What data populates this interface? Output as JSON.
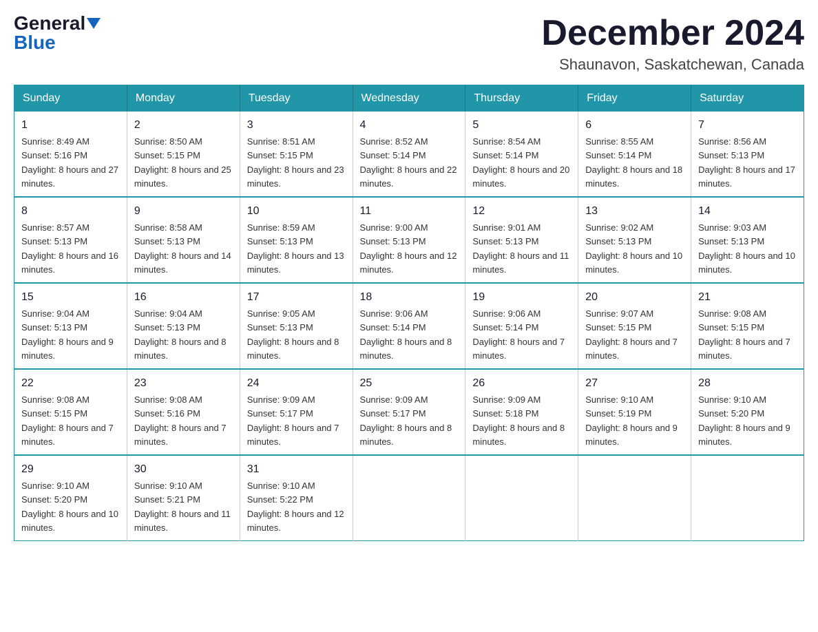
{
  "header": {
    "logo_general": "General",
    "logo_blue": "Blue",
    "month_title": "December 2024",
    "location": "Shaunavon, Saskatchewan, Canada"
  },
  "days_of_week": [
    "Sunday",
    "Monday",
    "Tuesday",
    "Wednesday",
    "Thursday",
    "Friday",
    "Saturday"
  ],
  "weeks": [
    [
      {
        "day": "1",
        "sunrise": "8:49 AM",
        "sunset": "5:16 PM",
        "daylight": "8 hours and 27 minutes."
      },
      {
        "day": "2",
        "sunrise": "8:50 AM",
        "sunset": "5:15 PM",
        "daylight": "8 hours and 25 minutes."
      },
      {
        "day": "3",
        "sunrise": "8:51 AM",
        "sunset": "5:15 PM",
        "daylight": "8 hours and 23 minutes."
      },
      {
        "day": "4",
        "sunrise": "8:52 AM",
        "sunset": "5:14 PM",
        "daylight": "8 hours and 22 minutes."
      },
      {
        "day": "5",
        "sunrise": "8:54 AM",
        "sunset": "5:14 PM",
        "daylight": "8 hours and 20 minutes."
      },
      {
        "day": "6",
        "sunrise": "8:55 AM",
        "sunset": "5:14 PM",
        "daylight": "8 hours and 18 minutes."
      },
      {
        "day": "7",
        "sunrise": "8:56 AM",
        "sunset": "5:13 PM",
        "daylight": "8 hours and 17 minutes."
      }
    ],
    [
      {
        "day": "8",
        "sunrise": "8:57 AM",
        "sunset": "5:13 PM",
        "daylight": "8 hours and 16 minutes."
      },
      {
        "day": "9",
        "sunrise": "8:58 AM",
        "sunset": "5:13 PM",
        "daylight": "8 hours and 14 minutes."
      },
      {
        "day": "10",
        "sunrise": "8:59 AM",
        "sunset": "5:13 PM",
        "daylight": "8 hours and 13 minutes."
      },
      {
        "day": "11",
        "sunrise": "9:00 AM",
        "sunset": "5:13 PM",
        "daylight": "8 hours and 12 minutes."
      },
      {
        "day": "12",
        "sunrise": "9:01 AM",
        "sunset": "5:13 PM",
        "daylight": "8 hours and 11 minutes."
      },
      {
        "day": "13",
        "sunrise": "9:02 AM",
        "sunset": "5:13 PM",
        "daylight": "8 hours and 10 minutes."
      },
      {
        "day": "14",
        "sunrise": "9:03 AM",
        "sunset": "5:13 PM",
        "daylight": "8 hours and 10 minutes."
      }
    ],
    [
      {
        "day": "15",
        "sunrise": "9:04 AM",
        "sunset": "5:13 PM",
        "daylight": "8 hours and 9 minutes."
      },
      {
        "day": "16",
        "sunrise": "9:04 AM",
        "sunset": "5:13 PM",
        "daylight": "8 hours and 8 minutes."
      },
      {
        "day": "17",
        "sunrise": "9:05 AM",
        "sunset": "5:13 PM",
        "daylight": "8 hours and 8 minutes."
      },
      {
        "day": "18",
        "sunrise": "9:06 AM",
        "sunset": "5:14 PM",
        "daylight": "8 hours and 8 minutes."
      },
      {
        "day": "19",
        "sunrise": "9:06 AM",
        "sunset": "5:14 PM",
        "daylight": "8 hours and 7 minutes."
      },
      {
        "day": "20",
        "sunrise": "9:07 AM",
        "sunset": "5:15 PM",
        "daylight": "8 hours and 7 minutes."
      },
      {
        "day": "21",
        "sunrise": "9:08 AM",
        "sunset": "5:15 PM",
        "daylight": "8 hours and 7 minutes."
      }
    ],
    [
      {
        "day": "22",
        "sunrise": "9:08 AM",
        "sunset": "5:15 PM",
        "daylight": "8 hours and 7 minutes."
      },
      {
        "day": "23",
        "sunrise": "9:08 AM",
        "sunset": "5:16 PM",
        "daylight": "8 hours and 7 minutes."
      },
      {
        "day": "24",
        "sunrise": "9:09 AM",
        "sunset": "5:17 PM",
        "daylight": "8 hours and 7 minutes."
      },
      {
        "day": "25",
        "sunrise": "9:09 AM",
        "sunset": "5:17 PM",
        "daylight": "8 hours and 8 minutes."
      },
      {
        "day": "26",
        "sunrise": "9:09 AM",
        "sunset": "5:18 PM",
        "daylight": "8 hours and 8 minutes."
      },
      {
        "day": "27",
        "sunrise": "9:10 AM",
        "sunset": "5:19 PM",
        "daylight": "8 hours and 9 minutes."
      },
      {
        "day": "28",
        "sunrise": "9:10 AM",
        "sunset": "5:20 PM",
        "daylight": "8 hours and 9 minutes."
      }
    ],
    [
      {
        "day": "29",
        "sunrise": "9:10 AM",
        "sunset": "5:20 PM",
        "daylight": "8 hours and 10 minutes."
      },
      {
        "day": "30",
        "sunrise": "9:10 AM",
        "sunset": "5:21 PM",
        "daylight": "8 hours and 11 minutes."
      },
      {
        "day": "31",
        "sunrise": "9:10 AM",
        "sunset": "5:22 PM",
        "daylight": "8 hours and 12 minutes."
      },
      null,
      null,
      null,
      null
    ]
  ]
}
